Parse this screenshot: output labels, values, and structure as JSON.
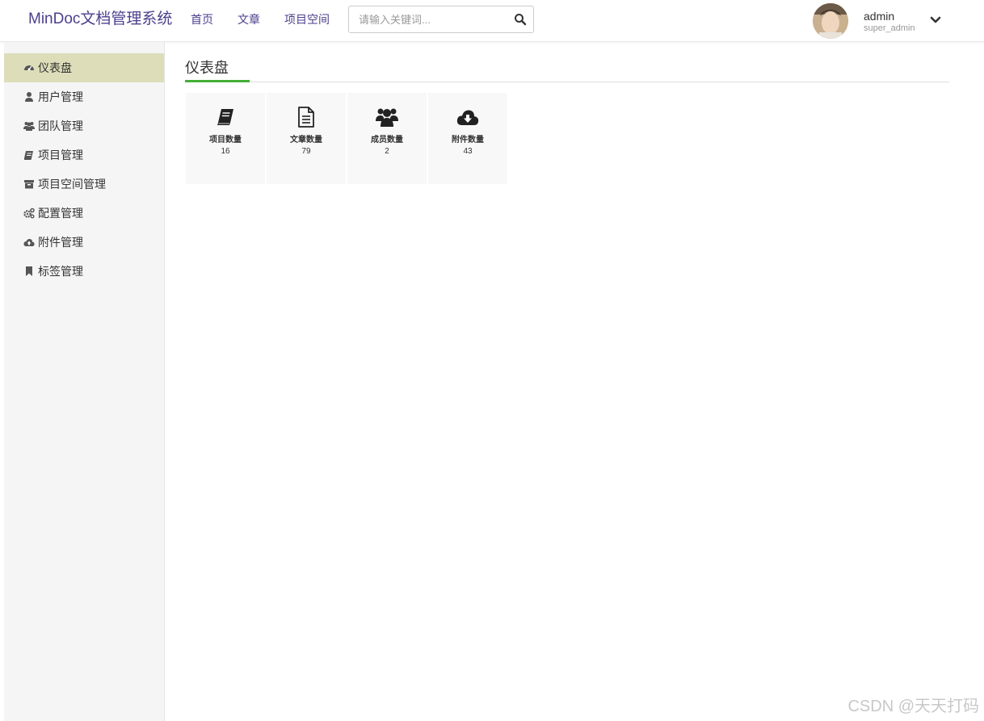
{
  "header": {
    "brand": "MinDoc文档管理系统",
    "nav": [
      {
        "label": "首页"
      },
      {
        "label": "文章"
      },
      {
        "label": "项目空间"
      }
    ],
    "search": {
      "placeholder": "请输入关键词...",
      "value": "",
      "icon": "search-icon"
    },
    "user": {
      "name": "admin",
      "role": "super_admin",
      "menu_icon": "chevron-down-icon"
    }
  },
  "sidebar": {
    "items": [
      {
        "label": "仪表盘",
        "icon": "dashboard-icon",
        "active": true
      },
      {
        "label": "用户管理",
        "icon": "user-icon"
      },
      {
        "label": "团队管理",
        "icon": "users-icon"
      },
      {
        "label": "项目管理",
        "icon": "book-icon"
      },
      {
        "label": "项目空间管理",
        "icon": "archive-icon"
      },
      {
        "label": "配置管理",
        "icon": "gears-icon"
      },
      {
        "label": "附件管理",
        "icon": "cloud-upload-icon"
      },
      {
        "label": "标签管理",
        "icon": "bookmark-icon"
      }
    ]
  },
  "main": {
    "title": "仪表盘",
    "cards": [
      {
        "label": "项目数量",
        "value": "16",
        "icon": "book-icon"
      },
      {
        "label": "文章数量",
        "value": "79",
        "icon": "file-text-icon"
      },
      {
        "label": "成员数量",
        "value": "2",
        "icon": "users-icon"
      },
      {
        "label": "附件数量",
        "value": "43",
        "icon": "cloud-download-icon"
      }
    ]
  },
  "watermark": "CSDN @天天打码",
  "colors": {
    "brand": "#4c3e8c",
    "active_menu": "#ddddb9",
    "accent": "#44b036",
    "sidebar_bg": "#f5f5f5"
  }
}
